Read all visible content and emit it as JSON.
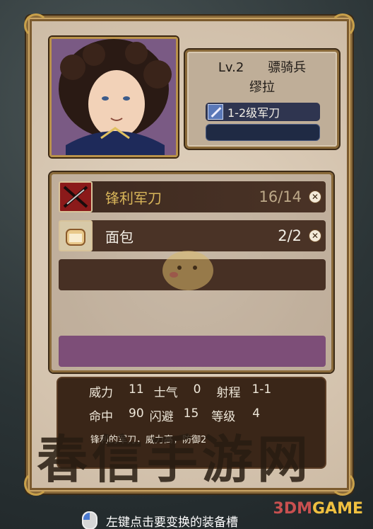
{
  "unit": {
    "level": "Lv.2",
    "class": "骠骑兵",
    "name": "缪拉",
    "equipped_weapon": "1-2级军刀"
  },
  "items": [
    {
      "name": "锋利军刀",
      "count": "16/14",
      "icon": "broken-sword-icon",
      "status": "unusable"
    },
    {
      "name": "面包",
      "count": "2/2",
      "icon": "bread-icon",
      "status": "normal"
    }
  ],
  "stats": {
    "labels": [
      "威力",
      "士气",
      "射程",
      "命中",
      "闪避",
      "等级"
    ],
    "power": "11",
    "morale": "0",
    "range": "1-1",
    "hit": "90",
    "evade": "15",
    "rank": "4",
    "desc": "锋利的军刀，威力高，防御2"
  },
  "watermark": "春信手游网",
  "logo": {
    "a": "3DM",
    "b": "GAME"
  },
  "hint": "左键点击要变换的装备槽",
  "colors": {
    "accent_gold": "#c8a04a",
    "slot_purple": "#7d4e78",
    "broken_text": "#d8b55a"
  }
}
